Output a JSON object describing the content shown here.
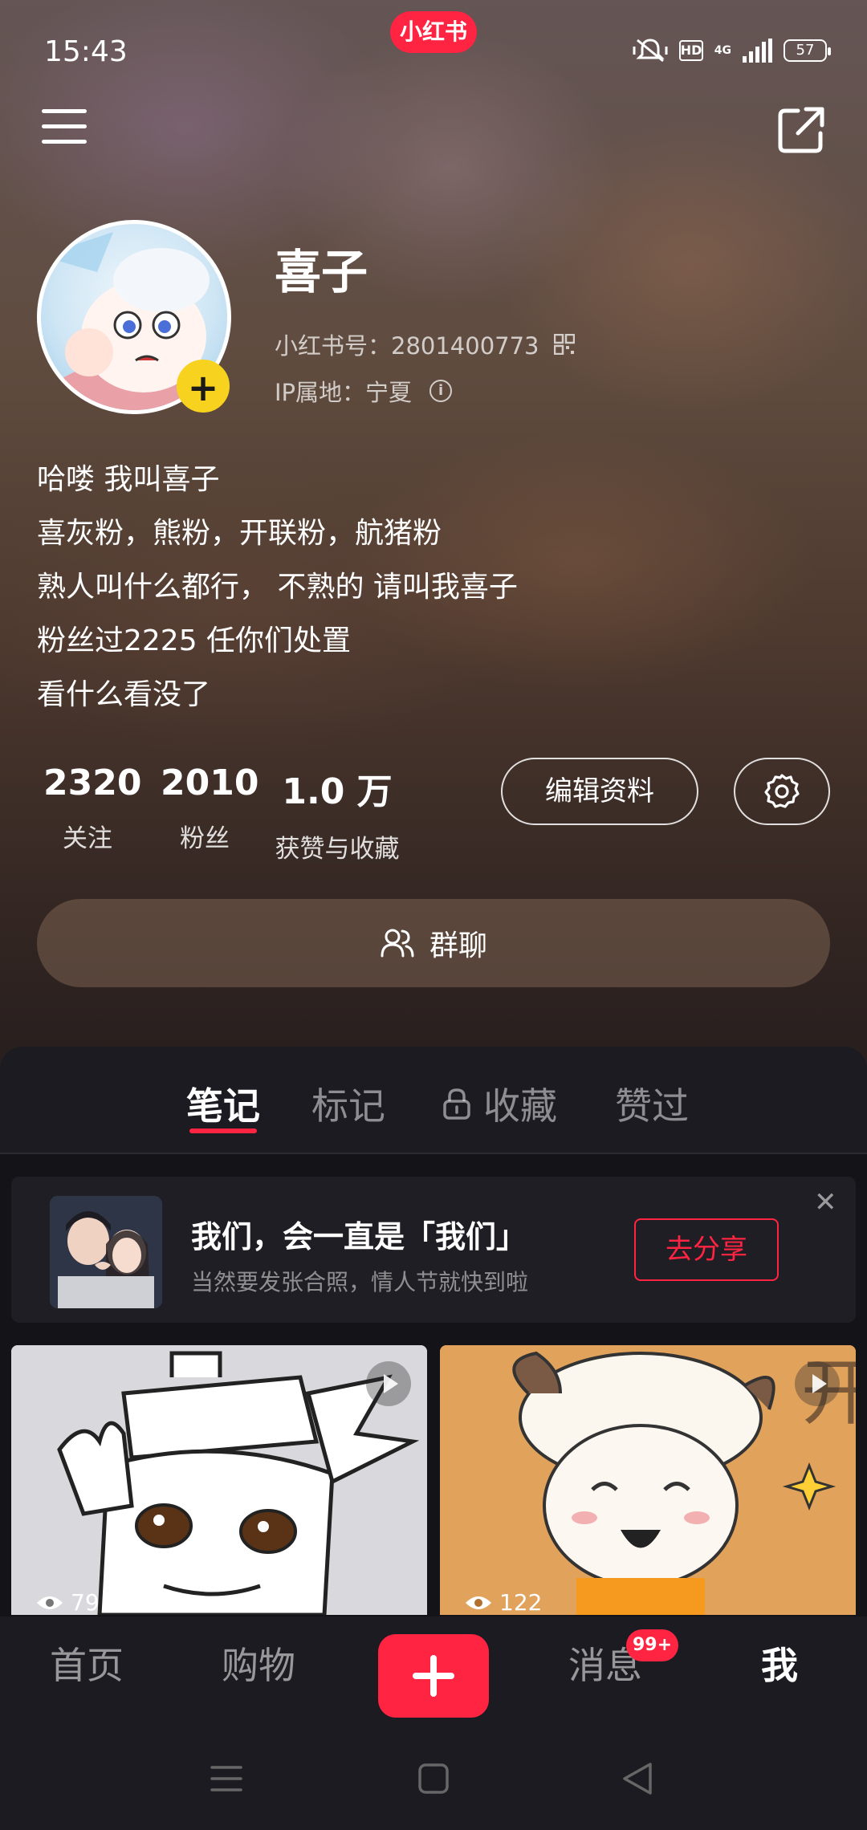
{
  "status_bar": {
    "time": "15:43",
    "app_badge": "小红书",
    "hd": "HD",
    "network": "4G",
    "battery": "57"
  },
  "profile": {
    "nickname": "喜子",
    "account_id": "小红书号：2801400773",
    "ip_location": "IP属地：宁夏",
    "bio": [
      "哈喽 我叫喜子",
      "喜灰粉，熊粉，开联粉，航猪粉",
      "熟人叫什么都行， 不熟的 请叫我喜子",
      "粉丝过2225 任你们处置",
      "看什么看没了"
    ]
  },
  "stats": [
    {
      "value": "2320",
      "label": "关注"
    },
    {
      "value": "2010",
      "label": "粉丝"
    },
    {
      "value": "1.0 万",
      "label": "获赞与收藏"
    }
  ],
  "actions": {
    "edit_profile": "编辑资料",
    "group_chat": "群聊"
  },
  "tabs": [
    {
      "label": "笔记",
      "active": true
    },
    {
      "label": "标记",
      "active": false
    },
    {
      "label": "收藏",
      "active": false,
      "locked": true
    },
    {
      "label": "赞过",
      "active": false
    }
  ],
  "promo": {
    "title": "我们，会一直是「我们」",
    "subtitle": "当然要发张合照，情人节就快到啦",
    "share_button": "去分享"
  },
  "notes": [
    {
      "views": "79",
      "is_video": true
    },
    {
      "views": "122",
      "is_video": true
    }
  ],
  "bottom_nav": {
    "home": "首页",
    "shop": "购物",
    "messages": "消息",
    "messages_badge": "99+",
    "me": "我"
  },
  "colors": {
    "brand_red": "#ff2442",
    "avatar_add_yellow": "#f7d21e",
    "panel_bg": "#1c1b22"
  },
  "icons": [
    "menu-icon",
    "share-icon",
    "qrcode-icon",
    "info-icon",
    "gear-icon",
    "group-icon",
    "lock-icon",
    "close-icon",
    "play-icon",
    "eye-icon",
    "plus-icon"
  ]
}
